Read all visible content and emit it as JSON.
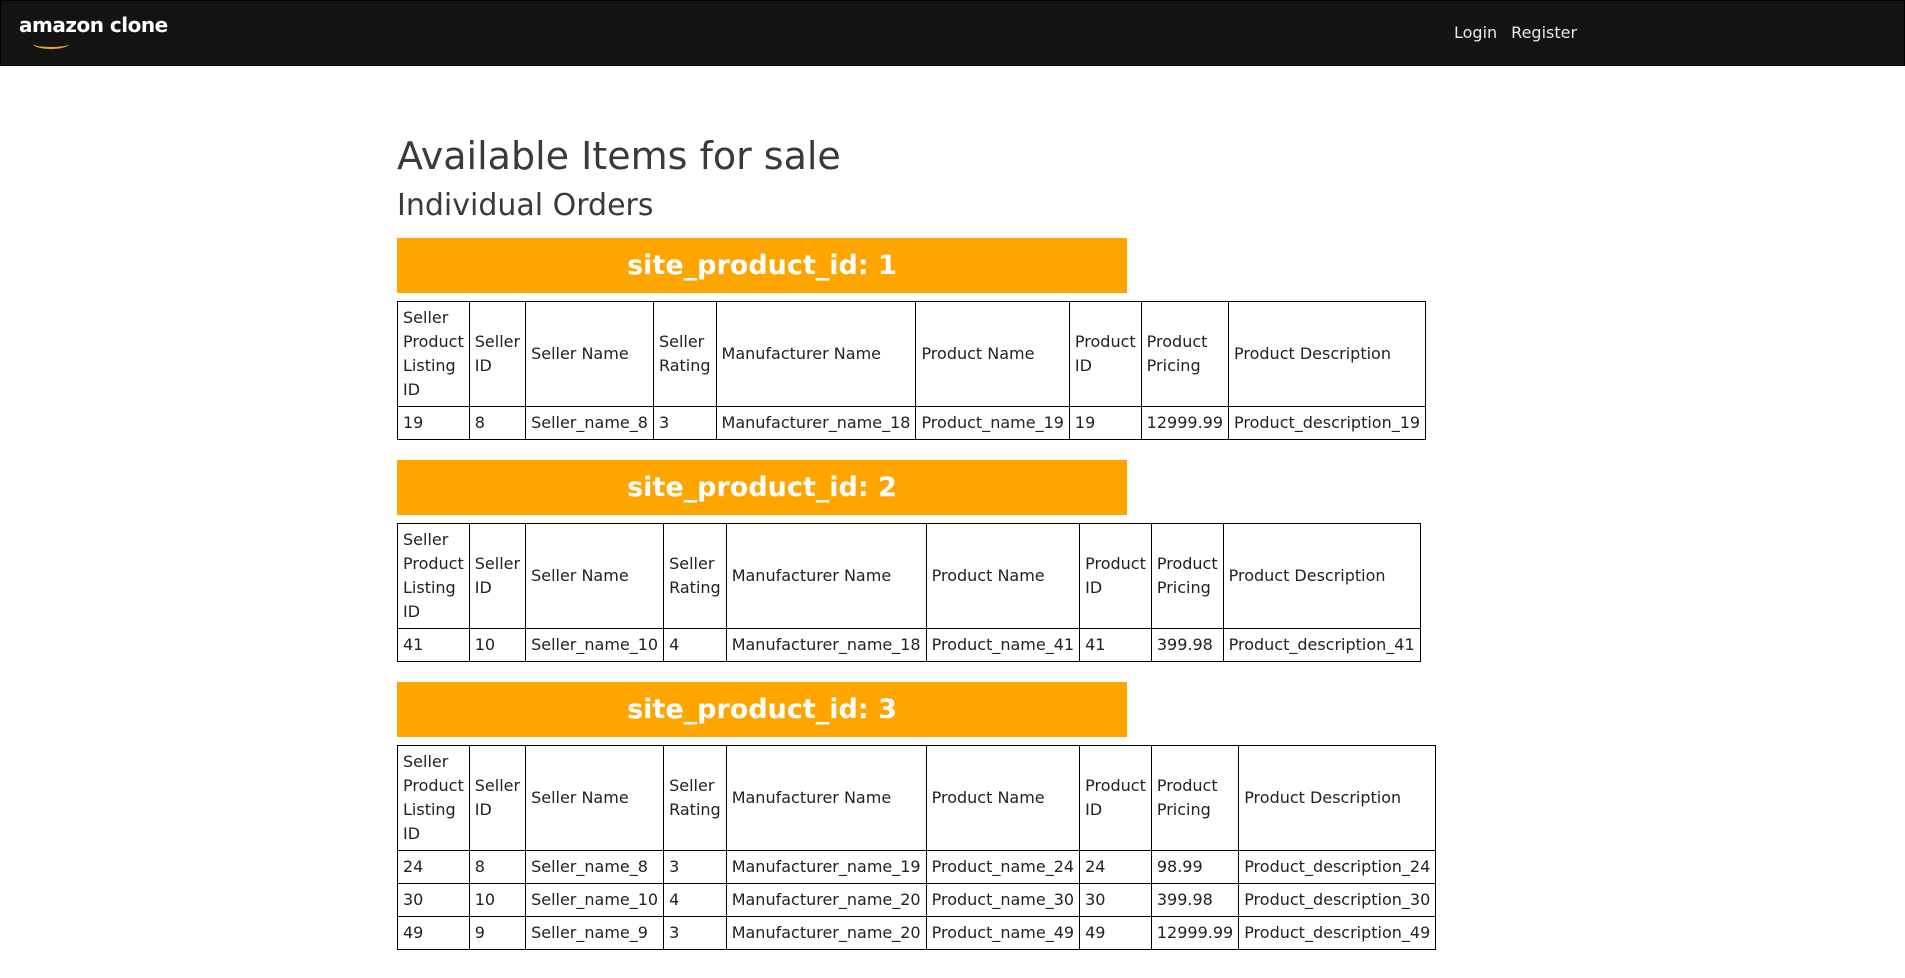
{
  "navbar": {
    "logo_text": "amazon clone",
    "login_label": "Login",
    "register_label": "Register"
  },
  "page": {
    "title": "Available Items for sale",
    "subtitle": "Individual Orders"
  },
  "columns": [
    "Seller Product Listing ID",
    "Seller ID",
    "Seller Name",
    "Seller Rating",
    "Manufacturer Name",
    "Product Name",
    "Product ID",
    "Product Pricing",
    "Product Description"
  ],
  "groups": [
    {
      "header": "site_product_id: 1",
      "rows": [
        [
          "19",
          "8",
          "Seller_name_8",
          "3",
          "Manufacturer_name_18",
          "Product_name_19",
          "19",
          "12999.99",
          "Product_description_19"
        ]
      ]
    },
    {
      "header": "site_product_id: 2",
      "rows": [
        [
          "41",
          "10",
          "Seller_name_10",
          "4",
          "Manufacturer_name_18",
          "Product_name_41",
          "41",
          "399.98",
          "Product_description_41"
        ]
      ]
    },
    {
      "header": "site_product_id: 3",
      "rows": [
        [
          "24",
          "8",
          "Seller_name_8",
          "3",
          "Manufacturer_name_19",
          "Product_name_24",
          "24",
          "98.99",
          "Product_description_24"
        ],
        [
          "30",
          "10",
          "Seller_name_10",
          "4",
          "Manufacturer_name_20",
          "Product_name_30",
          "30",
          "399.98",
          "Product_description_30"
        ],
        [
          "49",
          "9",
          "Seller_name_9",
          "3",
          "Manufacturer_name_20",
          "Product_name_49",
          "49",
          "12999.99",
          "Product_description_49"
        ]
      ]
    }
  ]
}
